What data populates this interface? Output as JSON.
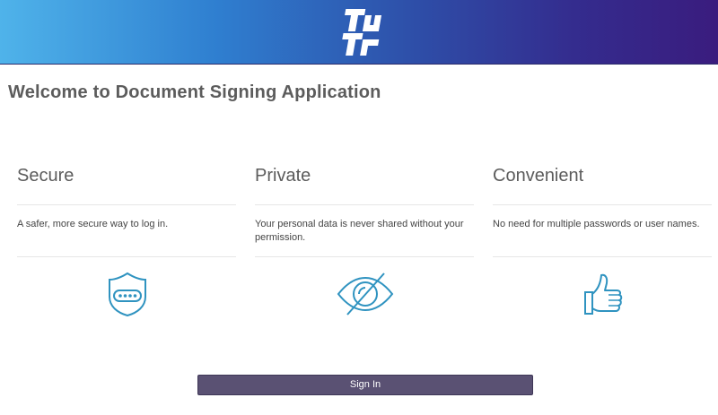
{
  "header": {
    "logo_icon": "tutr-logo-icon"
  },
  "page": {
    "title": "Welcome to Document Signing Application"
  },
  "features": [
    {
      "heading": "Secure",
      "description": "A safer, more secure way to log in.",
      "icon": "shield-password-icon"
    },
    {
      "heading": "Private",
      "description": "Your personal data is never shared without your permission.",
      "icon": "eye-slash-icon"
    },
    {
      "heading": "Convenient",
      "description": "No need for multiple passwords or user names.",
      "icon": "thumbs-up-icon"
    }
  ],
  "actions": {
    "sign_in_label": "Sign In"
  },
  "colors": {
    "icon": "#2f93c0",
    "button": "#5a5173",
    "header_start": "#4fb3ea",
    "header_end": "#3a1c7e"
  }
}
